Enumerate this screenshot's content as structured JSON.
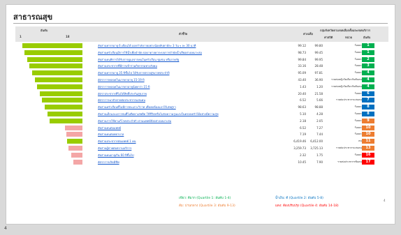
{
  "page": {
    "title": "สาธารณสุข",
    "page_number": "4",
    "bottom_number": "4"
  },
  "header": {
    "rank_label": "อันดับ",
    "rank_min": "1",
    "rank_max": "18",
    "indicator_label": "ตัวชี้วัด",
    "avg_label": "ค่าเฉลี่ย",
    "group_label": "กลุ่มจังหวัดตามเขตเลือกตั้งและเขตบริการ",
    "value_label": "ค่าสถิติ",
    "unit_label": "หน่วย",
    "rank_col_label": "อันดับ"
  },
  "rows": [
    {
      "bar_pct": 0.96,
      "bar_color": "#99cc00",
      "indicator": "สัดส่วนทารกอายุ 6 เดือนได้ ออกกำลังกายอย่างน้อยสัปดาห์ละ 3 วัน ๆ ละ 30 นาที",
      "avg": "99.12",
      "value": "99.80",
      "unit": "ร้อยละ",
      "rank": "1",
      "rank_color": "#00b050"
    },
    {
      "bar_pct": 0.92,
      "bar_color": "#99cc00",
      "indicator": "สัดส่วนครัวเรือนมีการใช้น้ำเพื่อบำบัด บ่อบาดาลดาระบบการบำบัดน้ำเสียอย่างเหมาะสม",
      "avg": "98.73",
      "value": "99.45",
      "unit": "ร้อยละ",
      "rank": "1",
      "rank_color": "#00b050"
    },
    {
      "bar_pct": 0.88,
      "bar_color": "#99cc00",
      "indicator": "สัดส่วนคนพิการได้รับการดูแลจากคนในครัวเรือน ชุมชน หรือภาครัฐ",
      "avg": "99.84",
      "value": "99.95",
      "unit": "ร้อยละ",
      "rank": "2",
      "rank_color": "#00b050"
    },
    {
      "bar_pct": 0.84,
      "bar_color": "#99cc00",
      "indicator": "สัดส่วนประชากรที่มีการเข้าร่วมกิจกรรมทางสังคม",
      "avg": "33.16",
      "value": "28.48",
      "unit": "ร้อยละ",
      "rank": "3",
      "rank_color": "#00b050"
    },
    {
      "bar_pct": 0.8,
      "bar_color": "#99cc00",
      "indicator": "สัดส่วนทารกอายุ 35 ปีขึ้นไป ได้รับการตรวจสุขภาพประจำปี",
      "avg": "95.09",
      "value": "97.81",
      "unit": "ร้อยละ",
      "rank": "4",
      "rank_color": "#00b050"
    },
    {
      "bar_pct": 0.76,
      "bar_color": "#99cc00",
      "indicator": "อัตราการคลอดในมารดาอายุ 15-19 ปี",
      "avg": "43.40",
      "value": "36.90",
      "unit": "รายต่อหญิงวัยเดียวกันพันคน",
      "rank": "4",
      "rank_color": "#00b050"
    },
    {
      "bar_pct": 0.72,
      "bar_color": "#99cc00",
      "indicator": "อัตราการคลอดในมารดาอายุน้อยกว่า 15 ปี",
      "avg": "1.43",
      "value": "1.20",
      "unit": "รายต่อหญิงวัยเดียวกันพันคน",
      "rank": "4",
      "rank_color": "#00b050"
    },
    {
      "bar_pct": 0.68,
      "bar_color": "#99cc00",
      "indicator": "อัตราประชากรที่ไม่ได้สิทธิ์ประกันสุขภาพ",
      "avg": "20.40",
      "value": "21.58",
      "unit": "ร้อยละ",
      "rank": "6",
      "rank_color": "#0070c0"
    },
    {
      "bar_pct": 0.64,
      "bar_color": "#99cc00",
      "indicator": "อัตราการฆ่าตัวตายต่อประชากรแสนคน",
      "avg": "6.52",
      "value": "5.66",
      "unit": "รายต่อประชากรแสนคน",
      "rank": "7",
      "rank_color": "#0070c0"
    },
    {
      "bar_pct": 0.6,
      "bar_color": "#99cc00",
      "indicator": "สัดส่วนครัวเรือนที่ไม่มีการทะเลาะวิวาท เพื่อลดห้องแถวไร้เสพสุรา",
      "avg": "98.63",
      "value": "98.88",
      "unit": "ร้อยละ",
      "rank": "8",
      "rank_color": "#0070c0"
    },
    {
      "bar_pct": 0.56,
      "bar_color": "#99cc00",
      "indicator": "สัดส่วนเด็กและเยาวชนที่ไม่ติดยาเสพติด ใช้ชีวิตหรือไม่ก่อความรุนแรงในครอบครัวได้อย่างมีความสุข",
      "avg": "5.10",
      "value": "4.28",
      "unit": "ร้อยละ",
      "rank": "8",
      "rank_color": "#0070c0"
    },
    {
      "bar_pct": 0.52,
      "bar_color": "#99cc00",
      "indicator": "สัดส่วนการใช้ยาแก้โรคประจำตัว ตามแพทย์สั่งอย่างเหมาะสม",
      "avg": "2.18",
      "value": "2.05",
      "unit": "ร้อยละ",
      "rank": "9",
      "rank_color": "#ed7d31"
    },
    {
      "bar_pct": 0.28,
      "bar_color": "#f4a6a6",
      "indicator": "สัดส่วนคนต่อแพทย์",
      "avg": "6.52",
      "value": "7.27",
      "unit": "ร้อยละ",
      "rank": "10",
      "rank_color": "#ed7d31"
    },
    {
      "bar_pct": 0.26,
      "bar_color": "#f4a6a6",
      "indicator": "สัดส่วนคนต่อพยาบาล",
      "avg": "7.19",
      "value": "7.44",
      "unit": "ร้อยละ",
      "rank": "10",
      "rank_color": "#ed7d31"
    },
    {
      "bar_pct": 0.24,
      "bar_color": "#99cc00",
      "indicator": "สัดส่วนประชากรต่อแพทย์ 1 คน",
      "avg": "6,419.46",
      "value": "6,412.00",
      "unit": "คน",
      "rank": "11",
      "rank_color": "#ed7d31"
    },
    {
      "bar_pct": 0.22,
      "bar_color": "#f4a6a6",
      "indicator": "สัดส่วนผู้ป่วยต่อสถานบริการ",
      "avg": "3,259.73",
      "value": "3,725.13",
      "unit": "รายต่อประชากรแสนคน",
      "rank": "13",
      "rank_color": "#ed7d31"
    },
    {
      "bar_pct": 0.18,
      "bar_color": "#f4a6a6",
      "indicator": "สัดส่วนคนอายุเกิน 60 ปีขึ้นไป",
      "avg": "2.32",
      "value": "1.75",
      "unit": "ร้อยละ",
      "rank": "16",
      "rank_color": "#ff0000"
    },
    {
      "bar_pct": 0.14,
      "bar_color": "#f4a6a6",
      "indicator": "อัตราการเกิดมีชีพ",
      "avg": "10.45",
      "value": "7.90",
      "unit": "รายต่อประชากรพันคน",
      "rank": "17",
      "rank_color": "#ff0000"
    }
  ],
  "legend": {
    "q1": "เขียว: ดีมาก (Quartile 1: อันดับ 1-4)",
    "q1_color": "#00b050",
    "q2": "น้ำเงิน: ดี (Quartile 2: อันดับ 5-8)",
    "q2_color": "#0070c0",
    "q3": "ส้ม: ปานกลาง (Quartile 3: อันดับ 9-13)",
    "q3_color": "#ed7d31",
    "q4": "แดง: ต้องปรับปรุง (Quartile 4: อันดับ 14-18)",
    "q4_color": "#ff0000"
  }
}
